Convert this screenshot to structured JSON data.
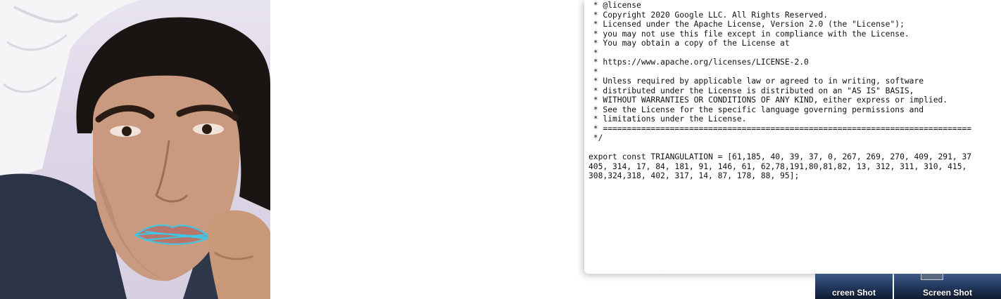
{
  "webcam": {
    "landmark_color": "#3cc7e6"
  },
  "visualization": {
    "point_color": "#5a5fd6",
    "axis_colors": {
      "y": "#9be26b",
      "x": "#f08a50",
      "z": "#4f93e6"
    }
  },
  "editor": {
    "lines": [
      " * @license",
      " * Copyright 2020 Google LLC. All Rights Reserved.",
      " * Licensed under the Apache License, Version 2.0 (the \"License\");",
      " * you may not use this file except in compliance with the License.",
      " * You may obtain a copy of the License at",
      " *",
      " * https://www.apache.org/licenses/LICENSE-2.0",
      " *",
      " * Unless required by applicable law or agreed to in writing, software",
      " * distributed under the License is distributed on an \"AS IS\" BASIS,",
      " * WITHOUT WARRANTIES OR CONDITIONS OF ANY KIND, either express or implied.",
      " * See the License for the specific language governing permissions and",
      " * limitations under the License.",
      " * =============================================================================",
      " */",
      "",
      "export const TRIANGULATION = [61,185, 40, 39, 37, 0, 267, 269, 270, 409, 291, 37",
      "405, 314, 17, 84, 181, 91, 146, 61, 62,78,191,80,81,82, 13, 312, 311, 310, 415,",
      "308,324,318, 402, 317, 14, 87, 178, 88, 95];"
    ]
  },
  "dock": {
    "items": [
      {
        "label": "creen Shot"
      },
      {
        "label": "Screen Shot"
      }
    ]
  }
}
